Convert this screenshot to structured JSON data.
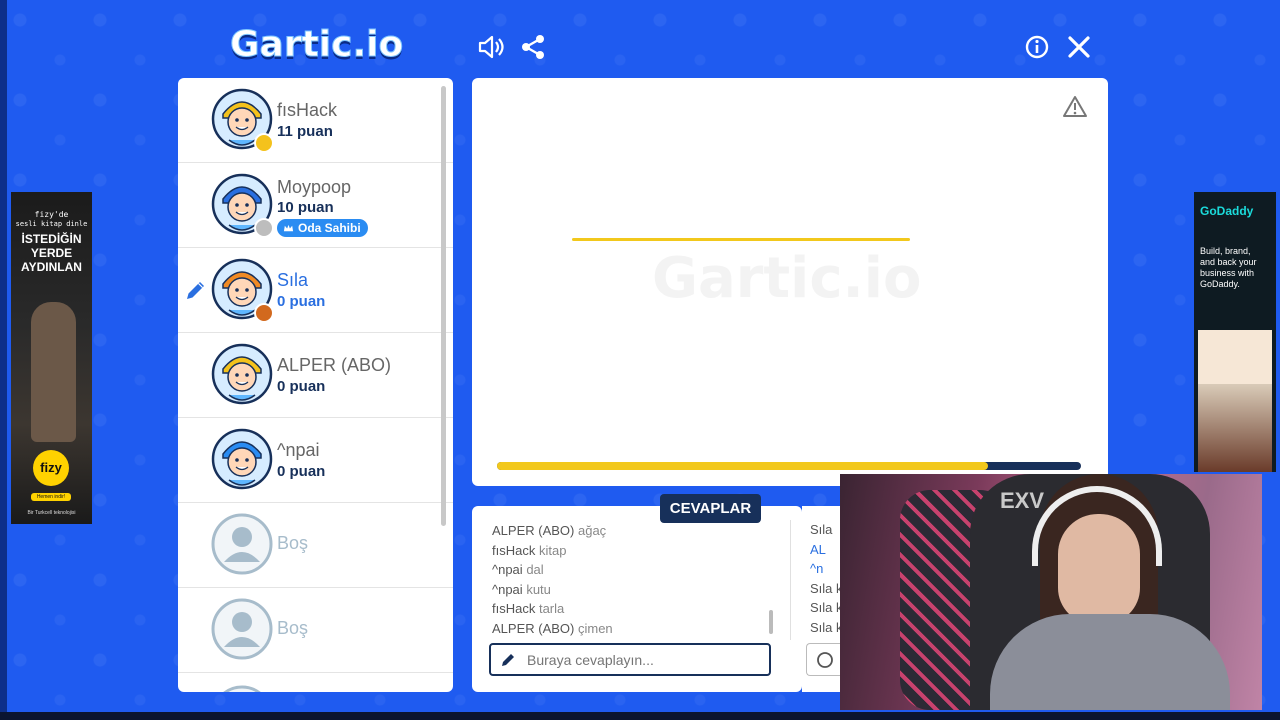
{
  "app": {
    "logo_text": "Gartic.io"
  },
  "header_icons": [
    "sound-icon",
    "share-icon",
    "info-icon",
    "close-icon"
  ],
  "players": [
    {
      "name": "fısHack",
      "points": "11 puan",
      "status_color": "#f4c21c",
      "drawing": false,
      "avatar_hair": "#f4c21c"
    },
    {
      "name": "Moypoop",
      "points": "10 puan",
      "status_color": "#bdbdbd",
      "drawing": false,
      "badge": "Oda Sahibi",
      "avatar_hair": "#2a6fe0"
    },
    {
      "name": "Sıla",
      "points": "0 puan",
      "status_color": "#d2691e",
      "drawing": true,
      "avatar_hair": "#f08a24"
    },
    {
      "name": "ALPER (ABO)",
      "points": "0 puan",
      "status_color": null,
      "drawing": false,
      "avatar_hair": "#f4c21c"
    },
    {
      "name": "^npai",
      "points": "0 puan",
      "status_color": null,
      "drawing": false,
      "avatar_hair": "#2a8cf2"
    },
    {
      "name": "Boş",
      "points": "",
      "status_color": null,
      "drawing": false,
      "empty": true
    },
    {
      "name": "Boş",
      "points": "",
      "status_color": null,
      "drawing": false,
      "empty": true
    }
  ],
  "canvas": {
    "watermark": "Gartic.io",
    "timer_progress": 0.84
  },
  "answers": {
    "tab_label": "CEVAPLAR",
    "items": [
      {
        "user": "ALPER (ABO)",
        "text": "ağaç"
      },
      {
        "user": "fısHack",
        "text": "kitap"
      },
      {
        "user": "^npai",
        "text": "dal"
      },
      {
        "user": "^npai",
        "text": "kutu"
      },
      {
        "user": "fısHack",
        "text": "tarla"
      },
      {
        "user": "ALPER (ABO)",
        "text": "çimen"
      }
    ],
    "placeholder": "Buraya cevaplayın..."
  },
  "chat": {
    "items": [
      "Sıla",
      "AL",
      "^n",
      "Sıla k",
      "Sıla k",
      "Sıla k"
    ]
  },
  "ads": {
    "left": {
      "line1": "fizy'de",
      "line2": "sesli kitap dinle",
      "headline1": "İSTEDİĞİN",
      "headline2": "YERDE",
      "headline3": "AYDINLAN",
      "brand": "fizy",
      "cta": "Hemen indir!",
      "footer": "Bir Turkcell teknolojisi"
    },
    "right": {
      "brand": "GoDaddy",
      "text": "Build, brand, and back your business with GoDaddy."
    }
  }
}
